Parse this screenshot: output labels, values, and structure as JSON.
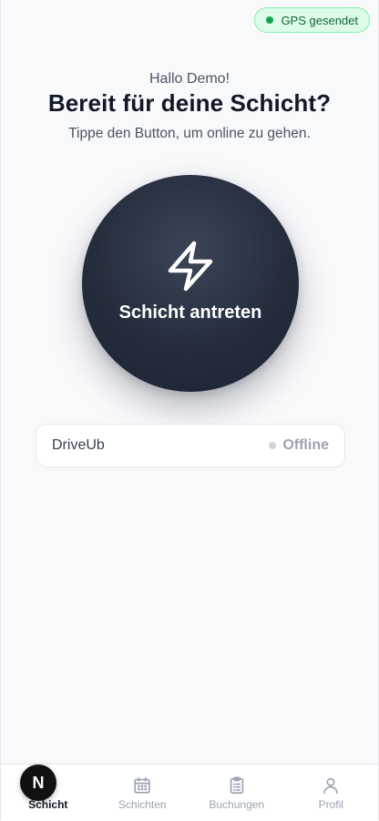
{
  "gps_badge": {
    "label": "GPS gesendet",
    "color": "#16a34a"
  },
  "header": {
    "greeting": "Hallo Demo!",
    "title": "Bereit für deine Schicht?",
    "subtitle": "Tippe den Button, um online zu gehen."
  },
  "shift_button": {
    "label": "Schicht antreten",
    "icon": "lightning-bolt-icon"
  },
  "status_card": {
    "company": "DriveUb",
    "status": "Offline",
    "status_color": "#d1d5db"
  },
  "bottom_nav": {
    "items": [
      {
        "label": "Schicht",
        "icon": "lightning-icon",
        "active": true
      },
      {
        "label": "Schichten",
        "icon": "calendar-icon",
        "active": false
      },
      {
        "label": "Buchungen",
        "icon": "clipboard-icon",
        "active": false
      },
      {
        "label": "Profil",
        "icon": "user-icon",
        "active": false
      }
    ]
  },
  "dev_badge": {
    "letter": "N"
  }
}
